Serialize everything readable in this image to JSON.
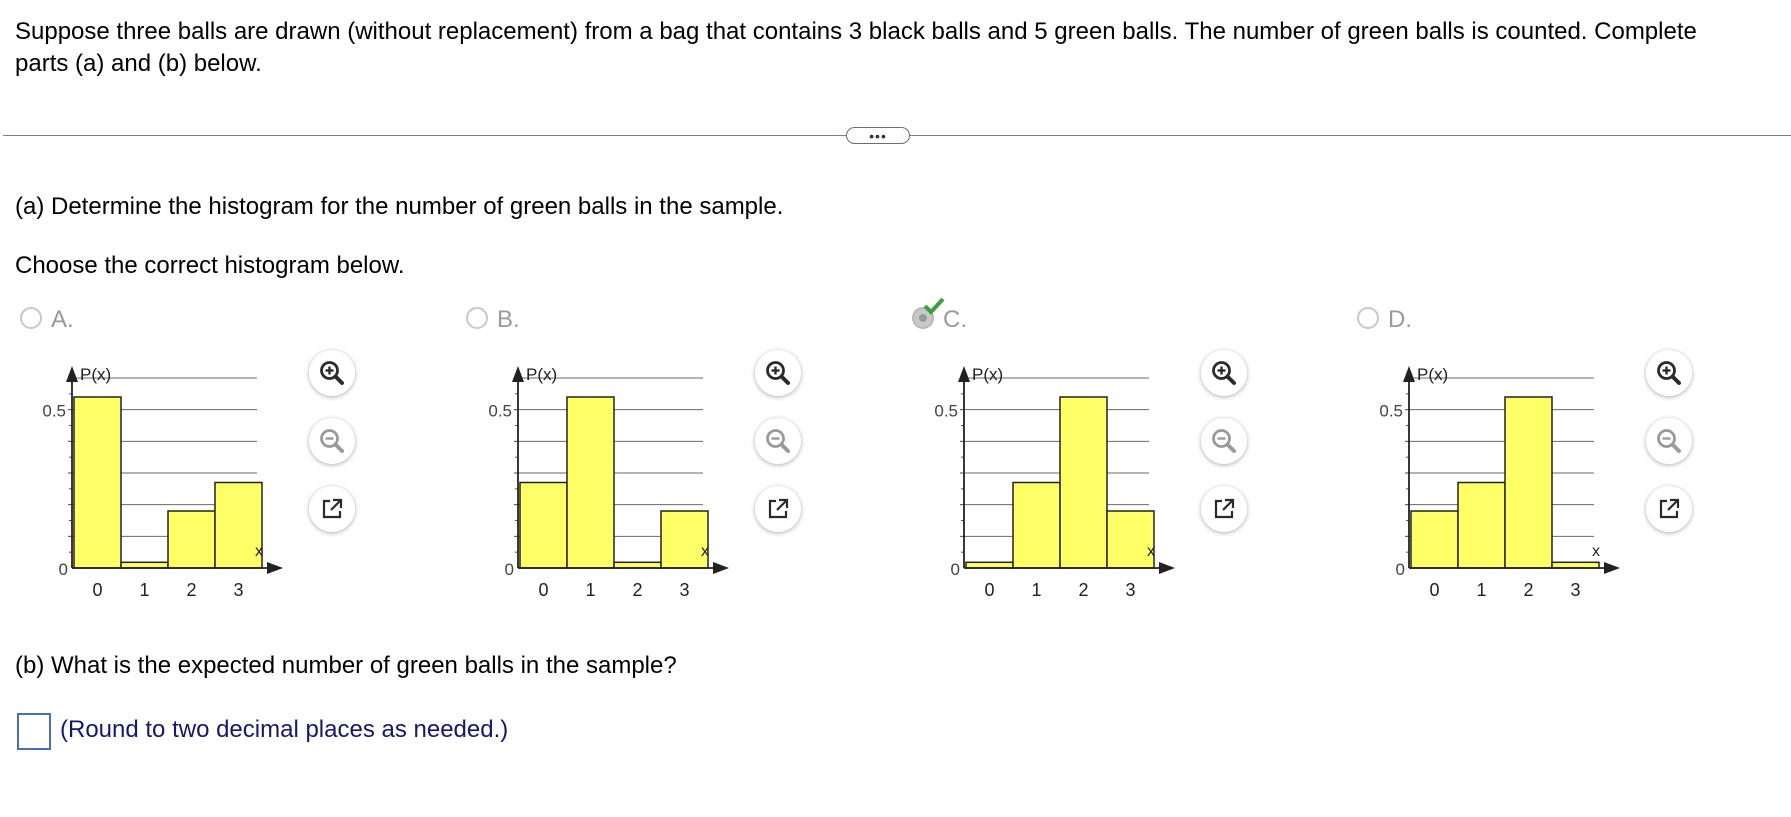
{
  "question": "Suppose three balls are drawn (without replacement) from a bag that contains 3 black balls and 5 green balls. The number of green balls is counted. Complete parts (a) and (b) below.",
  "expand_label": "•••",
  "part_a": {
    "prompt": "(a) Determine the histogram for the number of green balls in the sample.",
    "instruction": "Choose the correct histogram below."
  },
  "options": [
    {
      "label": "A.",
      "selected": false
    },
    {
      "label": "B.",
      "selected": false
    },
    {
      "label": "C.",
      "selected": true
    },
    {
      "label": "D.",
      "selected": false
    }
  ],
  "chart_data": [
    {
      "type": "bar",
      "ylabel": "P(x)",
      "xlabel": "x",
      "categories": [
        "0",
        "1",
        "2",
        "3"
      ],
      "values": [
        0.54,
        0.018,
        0.18,
        0.27
      ],
      "ylim": [
        0,
        0.6
      ],
      "yticks": [
        "0",
        "0.5"
      ],
      "grid": true
    },
    {
      "type": "bar",
      "ylabel": "P(x)",
      "xlabel": "x",
      "categories": [
        "0",
        "1",
        "2",
        "3"
      ],
      "values": [
        0.27,
        0.54,
        0.018,
        0.18
      ],
      "ylim": [
        0,
        0.6
      ],
      "yticks": [
        "0",
        "0.5"
      ],
      "grid": true
    },
    {
      "type": "bar",
      "ylabel": "P(x)",
      "xlabel": "x",
      "categories": [
        "0",
        "1",
        "2",
        "3"
      ],
      "values": [
        0.018,
        0.27,
        0.54,
        0.18
      ],
      "ylim": [
        0,
        0.6
      ],
      "yticks": [
        "0",
        "0.5"
      ],
      "grid": true
    },
    {
      "type": "bar",
      "ylabel": "P(x)",
      "xlabel": "x",
      "categories": [
        "0",
        "1",
        "2",
        "3"
      ],
      "values": [
        0.18,
        0.27,
        0.54,
        0.018
      ],
      "ylim": [
        0,
        0.6
      ],
      "yticks": [
        "0",
        "0.5"
      ],
      "grid": true
    }
  ],
  "tools": [
    "zoom-in-icon",
    "zoom-out-icon",
    "pop-out-icon"
  ],
  "colors": {
    "bar_fill": "#ffff66",
    "check": "#3aa03a",
    "hint": "#17176b"
  },
  "part_b": {
    "prompt": "(b) What is the expected number of green balls in the sample?",
    "answer_value": "",
    "hint": "(Round to two decimal places as needed.)"
  }
}
